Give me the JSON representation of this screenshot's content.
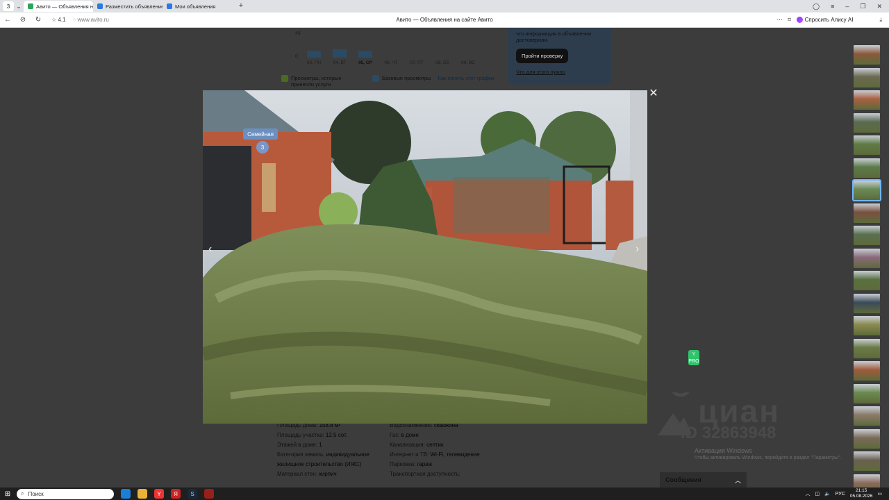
{
  "browser": {
    "tab_count": "3",
    "tabs": [
      {
        "label": "Авито — Объявления н",
        "favicon": "#2aa55a",
        "active": true
      },
      {
        "label": "Разместить объявление",
        "favicon": "#2a7ae2",
        "active": false
      },
      {
        "label": "Мои объявления",
        "favicon": "#2a7ae2",
        "active": false
      }
    ],
    "rating": "4.1",
    "url": "www.avito.ru",
    "page_title": "Авито — Объявления на сайте Авито",
    "ask_alice": "Спросить Алису AI"
  },
  "stats_chart": {
    "y_ticks": [
      "46",
      "0"
    ],
    "days": [
      {
        "label": "03, ПН",
        "value": 0.3,
        "current": false
      },
      {
        "label": "04, ВТ",
        "value": 0.35,
        "current": false
      },
      {
        "label": "05, СР",
        "value": 0.3,
        "current": true
      },
      {
        "label": "06, ЧТ",
        "value": 0,
        "current": false
      },
      {
        "label": "07, ПТ",
        "value": 0,
        "current": false
      },
      {
        "label": "08, СБ",
        "value": 0,
        "current": false
      },
      {
        "label": "09, ВС",
        "value": 0,
        "current": false
      }
    ],
    "legend_paid": "Просмотры, которые принесли услуги",
    "legend_base": "Базовые просмотры",
    "legend_link": "Как понять этот график"
  },
  "verify_card": {
    "text": "что информация в объявлении достоверная.",
    "button": "Пройти проверку",
    "link": "Что для этого нужно"
  },
  "props_left": [
    {
      "k": "Площадь дома:",
      "v": "158.8 м²"
    },
    {
      "k": "Площадь участка:",
      "v": "12.5 сот."
    },
    {
      "k": "Этажей в доме:",
      "v": "1"
    },
    {
      "k": "Категория земель:",
      "v": "индивидуальное жилищное строительство (ИЖС)"
    },
    {
      "k": "Материал стен:",
      "v": "кирпич"
    }
  ],
  "props_right": [
    {
      "k": "Водоснабжение:",
      "v": "скважина"
    },
    {
      "k": "Газ:",
      "v": "в доме"
    },
    {
      "k": "Канализация:",
      "v": "септик"
    },
    {
      "k": "Интернет и ТВ:",
      "v": "Wi-Fi, телевидение"
    },
    {
      "k": "Парковка:",
      "v": "гараж"
    },
    {
      "k": "Транспортная доступность:",
      "v": ""
    }
  ],
  "gallery": {
    "sign_text": "Семейная",
    "house_number": "3",
    "active_index": 6,
    "thumb_colors": [
      "#8a5a3c",
      "#6a6a50",
      "#a86040",
      "#5a6a50",
      "#5f7a45",
      "#5a7a4a",
      "#6a8a55",
      "#7a5040",
      "#5a7050",
      "#8a6a7a",
      "#5a7040",
      "#3a4a5a",
      "#8a8a50",
      "#6a7a45",
      "#a05a3a",
      "#6a8a50",
      "#8a7a6a",
      "#7a6a5a",
      "#6a6050",
      "#8a6a5a"
    ]
  },
  "watermark": {
    "brand": "циан",
    "id": "ID 32863948"
  },
  "windows_activation": {
    "title": "Активация Windows",
    "subtitle": "Чтобы активировать Windows, перейдите в раздел \"Параметры\"."
  },
  "messages_label": "Сообщения",
  "yandex_badge": "PRO",
  "taskbar": {
    "search": "Поиск",
    "lang": "РУС",
    "time": "21:15",
    "date": "05.08.2026"
  }
}
